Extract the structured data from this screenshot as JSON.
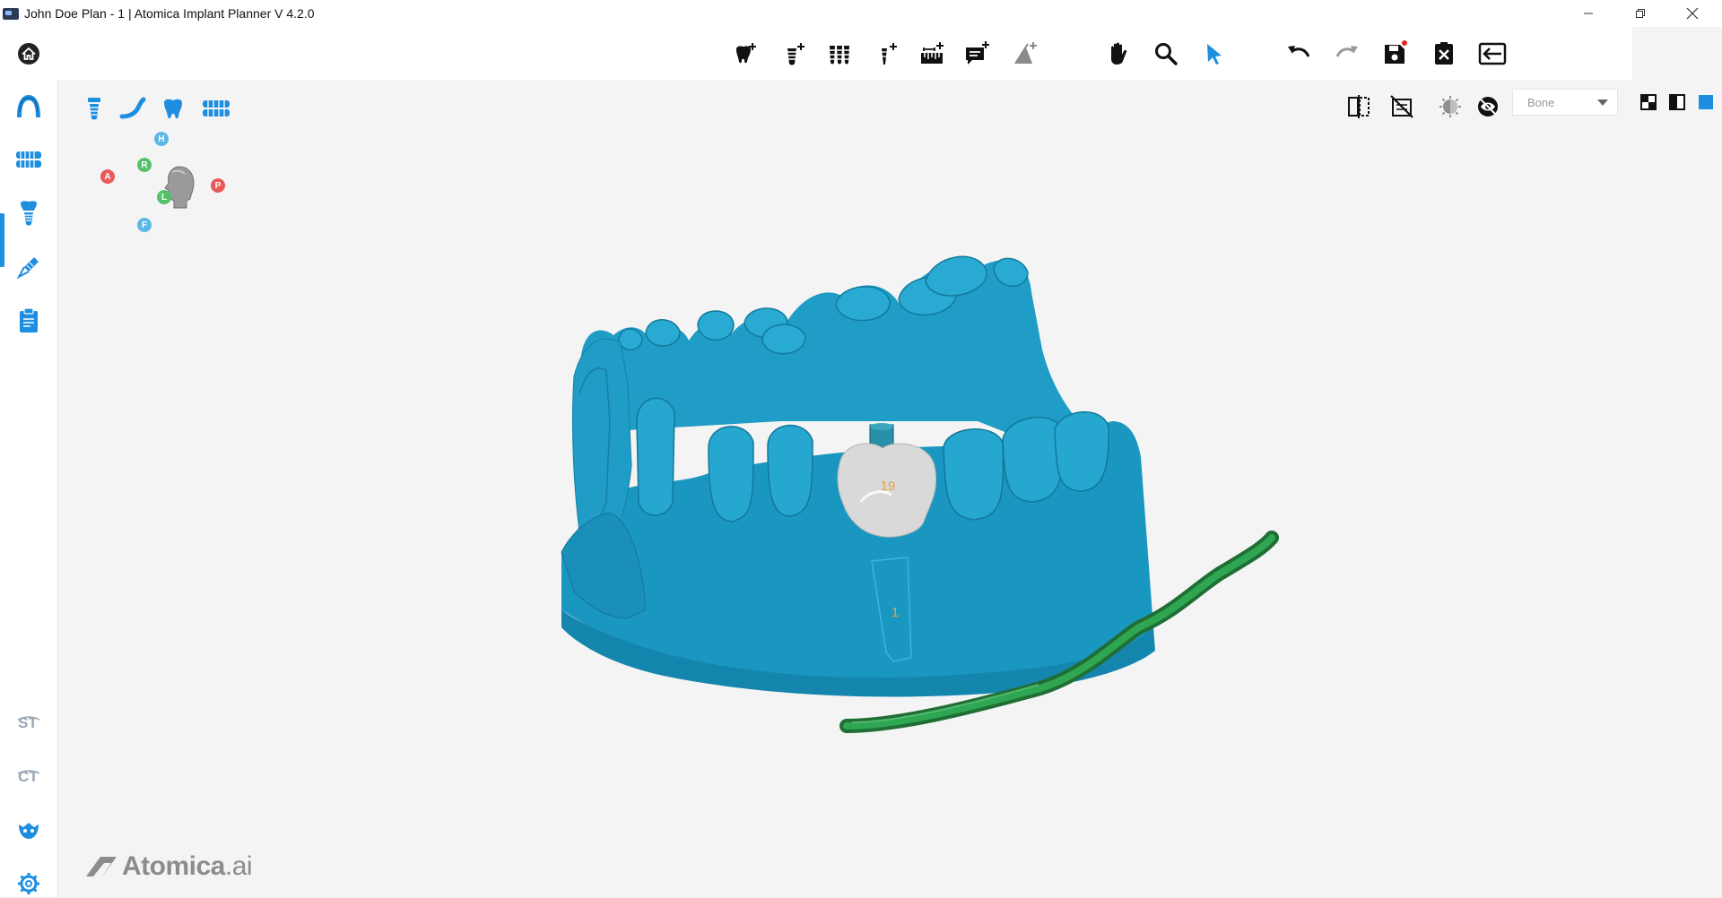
{
  "window": {
    "title": "John Doe Plan - 1 | Atomica Implant Planner V 4.2.0",
    "controls": [
      "minimize",
      "restore",
      "close"
    ]
  },
  "sidebar": {
    "items": [
      {
        "name": "home",
        "icon": "home-icon"
      },
      {
        "name": "jaw-scan",
        "icon": "arch-icon"
      },
      {
        "name": "dentition",
        "icon": "dentition-icon"
      },
      {
        "name": "implant",
        "icon": "implant-icon",
        "active": true
      },
      {
        "name": "surgical-guide",
        "icon": "drill-icon"
      },
      {
        "name": "report",
        "icon": "clipboard-icon"
      }
    ],
    "bottom_items": [
      {
        "name": "st-module",
        "icon": "st-icon"
      },
      {
        "name": "ct-module",
        "icon": "ct-icon"
      },
      {
        "name": "guide-module",
        "icon": "guide-icon"
      },
      {
        "name": "settings",
        "icon": "gear-icon"
      }
    ],
    "accent_color": "#1e8fe0"
  },
  "toolbar": {
    "tools": [
      {
        "name": "add-crown",
        "icon": "add-crown-icon"
      },
      {
        "name": "add-implant",
        "icon": "add-implant-icon"
      },
      {
        "name": "implant-library",
        "icon": "implant-library-icon"
      },
      {
        "name": "add-anchor-pin",
        "icon": "add-pin-icon"
      },
      {
        "name": "add-measurement",
        "icon": "add-ruler-icon"
      },
      {
        "name": "add-annotation",
        "icon": "add-comment-icon"
      },
      {
        "name": "add-angle",
        "icon": "add-angle-icon"
      },
      {
        "name": "pan",
        "icon": "hand-icon"
      },
      {
        "name": "zoom",
        "icon": "magnifier-icon"
      },
      {
        "name": "select",
        "icon": "pointer-icon",
        "active": true
      },
      {
        "name": "undo",
        "icon": "undo-icon"
      },
      {
        "name": "redo",
        "icon": "redo-icon",
        "disabled": true
      },
      {
        "name": "save",
        "icon": "save-icon",
        "unsaved": true
      },
      {
        "name": "close-plan",
        "icon": "close-document-icon"
      },
      {
        "name": "exit",
        "icon": "exit-icon"
      }
    ]
  },
  "viewport": {
    "object_tools": [
      {
        "name": "show-implants",
        "icon": "implant-outline-icon"
      },
      {
        "name": "show-nerve",
        "icon": "nerve-icon"
      },
      {
        "name": "show-crowns",
        "icon": "tooth-icon"
      },
      {
        "name": "show-arch",
        "icon": "arch-model-icon"
      }
    ],
    "view_tools": [
      {
        "name": "clip-plane",
        "icon": "clip-plane-icon"
      },
      {
        "name": "hide-scan",
        "icon": "hide-scan-icon"
      },
      {
        "name": "brightness",
        "icon": "brightness-icon"
      },
      {
        "name": "toggle-visibility",
        "icon": "hide-eye-icon"
      }
    ],
    "density": {
      "selected": "Bone"
    },
    "layouts": [
      {
        "name": "layout-quad",
        "icon": "layout-quad-icon"
      },
      {
        "name": "layout-split",
        "icon": "layout-split-icon"
      },
      {
        "name": "layout-single",
        "icon": "layout-single-icon",
        "active": true
      }
    ],
    "orientation": {
      "head": "H",
      "anterior": "A",
      "posterior": "P",
      "right": "R",
      "left": "L",
      "foot": "F",
      "colors": {
        "H": "#5bb8e6",
        "F": "#5bb8e6",
        "A": "#e85a5a",
        "P": "#e85a5a",
        "R": "#55c26b",
        "L": "#55c26b"
      }
    },
    "scene": {
      "crown_label": "19",
      "implant_label": "1",
      "model_color": "#1fa2cc",
      "crown_color": "#d9d9d9",
      "nerve_color": "#2b8a3e",
      "label_color": "#e8a33a"
    },
    "brand": {
      "name": "Atomica",
      "suffix": ".ai"
    }
  }
}
